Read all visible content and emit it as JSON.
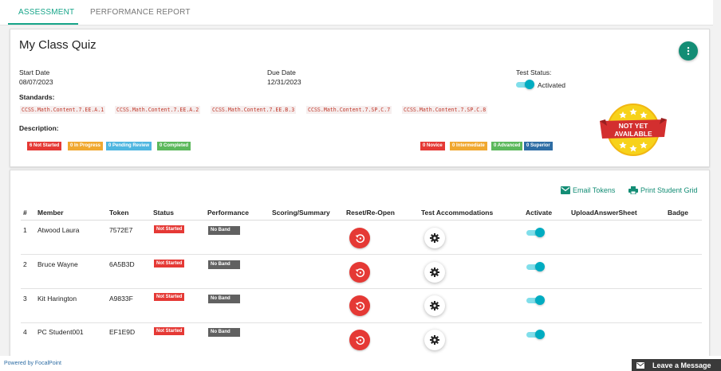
{
  "tabs": [
    {
      "label": "ASSESSMENT",
      "active": true
    },
    {
      "label": "PERFORMANCE REPORT",
      "active": false
    }
  ],
  "quiz": {
    "title": "My Class Quiz",
    "start_date_label": "Start Date",
    "start_date": "08/07/2023",
    "due_date_label": "Due Date",
    "due_date": "12/31/2023",
    "test_status_label": "Test Status:",
    "test_status": "Activated",
    "standards_label": "Standards:",
    "standards": [
      "CCSS.Math.Content.7.EE.A.1",
      "CCSS.Math.Content.7.EE.A.2",
      "CCSS.Math.Content.7.EE.B.3",
      "CCSS.Math.Content.7.SP.C.7",
      "CCSS.Math.Content.7.SP.C.8"
    ],
    "description_label": "Description:",
    "status_counts": [
      {
        "label": "6 Not Started",
        "color": "#e53935"
      },
      {
        "label": "0 In Progress",
        "color": "#f0a830"
      },
      {
        "label": "0 Pending Review",
        "color": "#4fb6e0"
      },
      {
        "label": "0 Completed",
        "color": "#5cb85c"
      }
    ],
    "band_counts": [
      {
        "label": "0 Novice",
        "color": "#e53935"
      },
      {
        "label": "0 Intermediate",
        "color": "#f0a830"
      },
      {
        "label": "0 Advanced",
        "color": "#5cb85c"
      },
      {
        "label": "0 Superior",
        "color": "#2e6da4"
      }
    ],
    "availability_badge": {
      "line1": "NOT YET",
      "line2": "AVAILABLE"
    }
  },
  "toolbar": {
    "email_tokens": "Email Tokens",
    "print_grid": "Print Student Grid"
  },
  "table": {
    "headers": [
      "#",
      "Member",
      "Token",
      "Status",
      "Performance",
      "Scoring/Summary",
      "Reset/Re-Open",
      "Test Accommodations",
      "Activate",
      "UploadAnswerSheet",
      "Badge"
    ],
    "rows": [
      {
        "num": "1",
        "member": "Atwood Laura",
        "token": "7572E7",
        "status": "Not Started",
        "performance": "No Band"
      },
      {
        "num": "2",
        "member": "Bruce Wayne",
        "token": "6A5B3D",
        "status": "Not Started",
        "performance": "No Band"
      },
      {
        "num": "3",
        "member": "Kit Harington",
        "token": "A9833F",
        "status": "Not Started",
        "performance": "No Band"
      },
      {
        "num": "4",
        "member": "PC Student001",
        "token": "EF1E9D",
        "status": "Not Started",
        "performance": "No Band"
      }
    ]
  },
  "footer": {
    "powered_by": "Powered by FocalPoint",
    "leave_message": "Leave a Message"
  },
  "colors": {
    "accent": "#17a589",
    "danger": "#e53935",
    "toggle": "#00acc1"
  }
}
